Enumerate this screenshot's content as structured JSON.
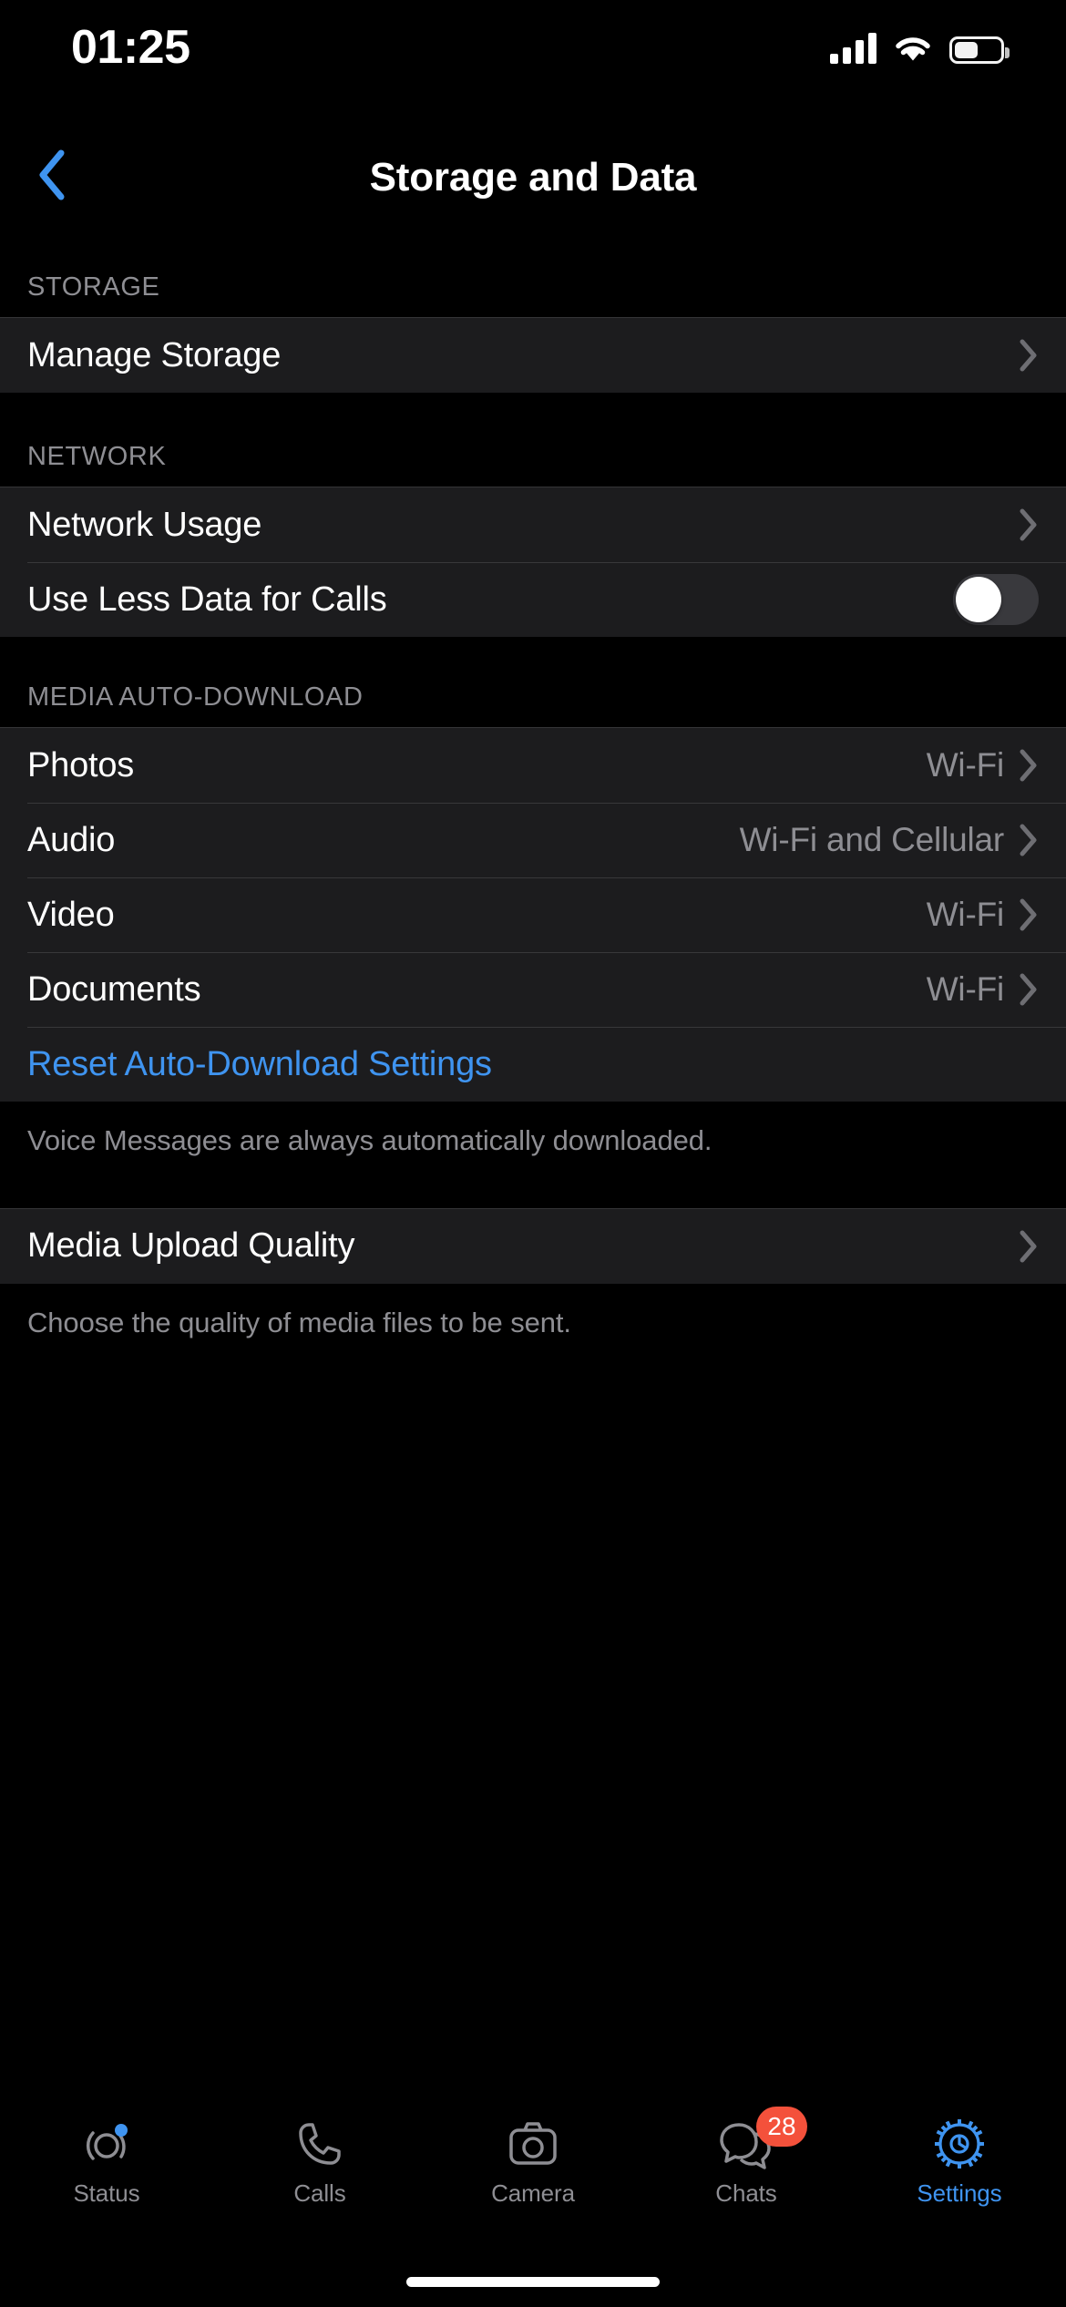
{
  "status_bar": {
    "time": "01:25",
    "cellular_icon": "cellular-signal-icon",
    "wifi_icon": "wifi-icon",
    "battery_icon": "battery-icon"
  },
  "nav": {
    "back_icon": "chevron-left-icon",
    "title": "Storage and Data"
  },
  "colors": {
    "accent_blue": "#3F94F0",
    "card_bg": "#1C1C1E",
    "page_bg": "#000000",
    "secondary_text": "#8E8E93",
    "separator": "#38383A",
    "badge_red": "#F4513B",
    "toggle_off_track": "#39393D"
  },
  "sections": {
    "storage": {
      "header": "STORAGE",
      "rows": [
        {
          "label": "Manage Storage",
          "accessory": "chevron-right-icon"
        }
      ]
    },
    "network": {
      "header": "NETWORK",
      "rows": [
        {
          "label": "Network Usage",
          "accessory": "chevron-right-icon"
        },
        {
          "label": "Use Less Data for Calls",
          "accessory": "toggle",
          "toggle_on": false
        }
      ]
    },
    "media_auto_download": {
      "header": "MEDIA AUTO-DOWNLOAD",
      "rows": [
        {
          "label": "Photos",
          "value": "Wi-Fi",
          "accessory": "chevron-right-icon"
        },
        {
          "label": "Audio",
          "value": "Wi-Fi and Cellular",
          "accessory": "chevron-right-icon"
        },
        {
          "label": "Video",
          "value": "Wi-Fi",
          "accessory": "chevron-right-icon"
        },
        {
          "label": "Documents",
          "value": "Wi-Fi",
          "accessory": "chevron-right-icon"
        },
        {
          "label": "Reset Auto-Download Settings",
          "style": "blue"
        }
      ],
      "footnote": "Voice Messages are always automatically downloaded."
    },
    "media_upload_quality": {
      "rows": [
        {
          "label": "Media Upload Quality",
          "accessory": "chevron-right-icon"
        }
      ],
      "footnote": "Choose the quality of media files to be sent."
    }
  },
  "tab_bar": {
    "items": [
      {
        "label": "Status",
        "icon": "status-rings-icon",
        "active": false,
        "dot": true
      },
      {
        "label": "Calls",
        "icon": "phone-icon",
        "active": false
      },
      {
        "label": "Camera",
        "icon": "camera-icon",
        "active": false
      },
      {
        "label": "Chats",
        "icon": "chats-bubbles-icon",
        "active": false,
        "badge": "28"
      },
      {
        "label": "Settings",
        "icon": "gear-icon",
        "active": true
      }
    ]
  }
}
